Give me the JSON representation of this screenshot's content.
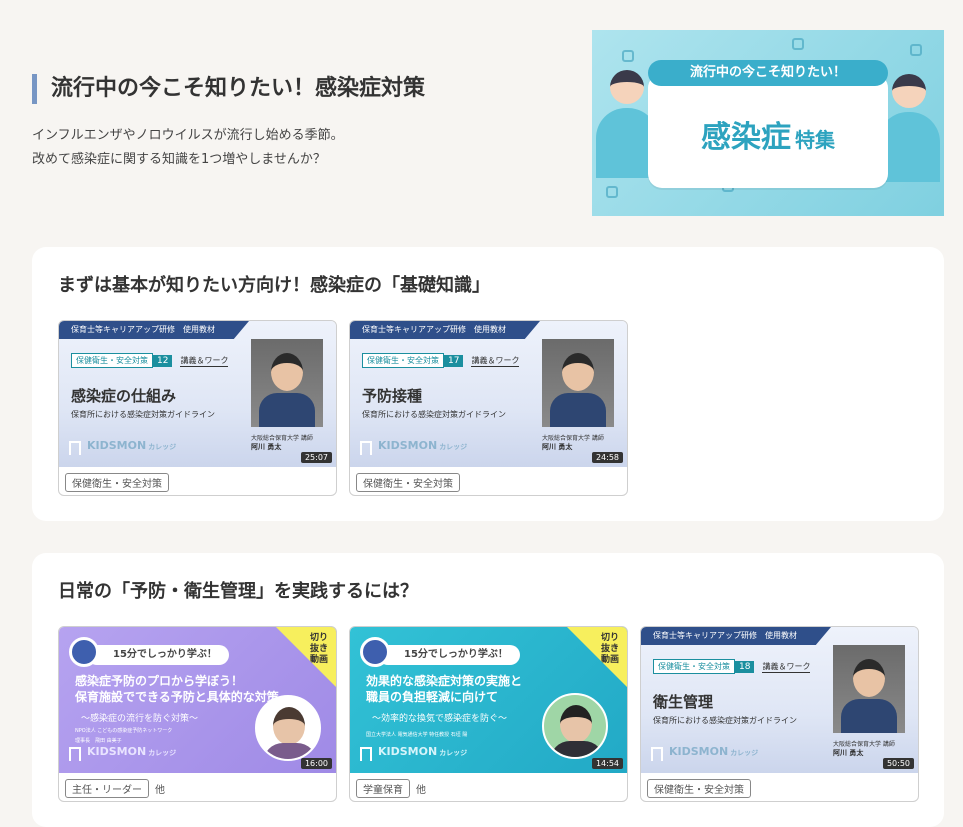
{
  "hero": {
    "title": "流行中の今こそ知りたい！感染症対策",
    "desc_line1": "インフルエンザやノロウイルスが流行し始める季節。",
    "desc_line2": "改めて感染症に関する知識を1つ増やしませんか？",
    "banner_ribbon": "流行中の今こそ知りたい！",
    "banner_main": "感染症",
    "banner_sub": "特集"
  },
  "sections": [
    {
      "title": "まずは基本が知りたい方向け！感染症の「基礎知識」",
      "cards": [
        {
          "header": "保育士等キャリアアップ研修　使用教材",
          "category": "保健衛生・安全対策",
          "number": "12",
          "kind": "講義＆ワーク",
          "title": "感染症の仕組み",
          "subtitle": "保育所における感染症対策ガイドライン",
          "affiliation": "大阪総合保育大学 講師",
          "lecturer": "阿川 勇太",
          "logo": "KIDSMON",
          "logo_sub": "カレッジ",
          "duration": "25:07",
          "tags": [
            "保健衛生・安全対策"
          ]
        },
        {
          "header": "保育士等キャリアアップ研修　使用教材",
          "category": "保健衛生・安全対策",
          "number": "17",
          "kind": "講義＆ワーク",
          "title": "予防接種",
          "subtitle": "保育所における感染症対策ガイドライン",
          "affiliation": "大阪総合保育大学 講師",
          "lecturer": "阿川 勇太",
          "logo": "KIDSMON",
          "logo_sub": "カレッジ",
          "duration": "24:58",
          "tags": [
            "保健衛生・安全対策"
          ]
        }
      ]
    },
    {
      "title": "日常の「予防・衛生管理」を実践するには？",
      "cards": [
        {
          "pill": "15分でしっかり学ぶ！",
          "clip": "切り抜き動画",
          "title_line1": "感染症予防のプロから学ぼう！",
          "title_line2": "保育施設でできる予防と具体的な対策",
          "subtitle": "～感染症の流行を防ぐ対策～",
          "affiliation": "NPO法人 こどもの感染症予防ネットワーク",
          "lecturer": "理事長　飛田 由美子",
          "logo": "KIDSMON",
          "logo_sub": "カレッジ",
          "duration": "16:00",
          "tags": [
            "主任・リーダー"
          ],
          "more": "他"
        },
        {
          "pill": "15分でしっかり学ぶ！",
          "clip": "切り抜き動画",
          "title_line1": "効果的な感染症対策の実施と",
          "title_line2": "職員の負担軽減に向けて",
          "subtitle": "～効率的な換気で感染症を防ぐ～",
          "affiliation": "国立大学法人 電気通信大学 特任教授",
          "lecturer": "石垣 陽",
          "logo": "KIDSMON",
          "logo_sub": "カレッジ",
          "duration": "14:54",
          "tags": [
            "学童保育"
          ],
          "more": "他"
        },
        {
          "header": "保育士等キャリアアップ研修　使用教材",
          "category": "保健衛生・安全対策",
          "number": "18",
          "kind": "講義＆ワーク",
          "title": "衛生管理",
          "subtitle": "保育所における感染症対策ガイドライン",
          "affiliation": "大阪総合保育大学 講師",
          "lecturer": "阿川 勇太",
          "logo": "KIDSMON",
          "logo_sub": "カレッジ",
          "duration": "50:50",
          "tags": [
            "保健衛生・安全対策"
          ]
        }
      ]
    }
  ]
}
